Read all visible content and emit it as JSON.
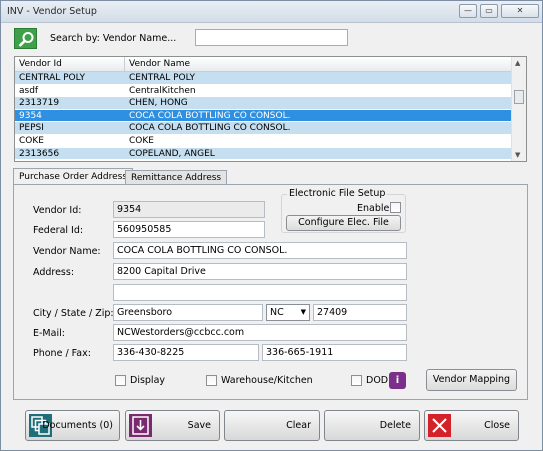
{
  "window": {
    "title": "INV - Vendor Setup",
    "minimize": "—",
    "maximize": "▭",
    "close": "✕"
  },
  "search": {
    "label": "Search by: Vendor Name...",
    "value": ""
  },
  "grid": {
    "columns": [
      "Vendor Id",
      "Vendor Name"
    ],
    "rows": [
      {
        "id": "CENTRAL POLY",
        "name": "CENTRAL POLY",
        "state": "alt"
      },
      {
        "id": "asdf",
        "name": "CentralKitchen",
        "state": ""
      },
      {
        "id": "2313719",
        "name": "CHEN, HONG",
        "state": "alt"
      },
      {
        "id": "9354",
        "name": "COCA COLA BOTTLING CO CONSOL.",
        "state": "sel"
      },
      {
        "id": "PEPSI",
        "name": "COCA COLA BOTTLING CO CONSOL.",
        "state": "alt"
      },
      {
        "id": "COKE",
        "name": "COKE",
        "state": ""
      },
      {
        "id": "2313656",
        "name": "COPELAND, ANGEL",
        "state": "alt"
      }
    ]
  },
  "tabs": {
    "active": "Purchase Order Address",
    "inactive": "Remittance Address"
  },
  "form": {
    "vendor_id_label": "Vendor Id:",
    "vendor_id": "9354",
    "federal_id_label": "Federal Id:",
    "federal_id": "560950585",
    "vendor_name_label": "Vendor Name:",
    "vendor_name": "COCA COLA BOTTLING CO CONSOL.",
    "address_label": "Address:",
    "address1": "8200 Capital Drive",
    "address2": "",
    "csz_label": "City / State / Zip:",
    "city": "Greensboro",
    "state": "NC",
    "zip": "27409",
    "email_label": "E-Mail:",
    "email": "NCWestorders@ccbcc.com",
    "phone_label": "Phone / Fax:",
    "phone": "336-430-8225",
    "fax": "336-665-1911",
    "display_label": "Display",
    "warehouse_label": "Warehouse/Kitchen",
    "dod_label": "DOD",
    "info_glyph": "i",
    "vendor_mapping": "Vendor Mapping"
  },
  "efile": {
    "title": "Electronic File Setup",
    "enable_label": "Enable",
    "configure": "Configure Elec. File"
  },
  "buttons": {
    "documents": "Documents (0)",
    "save": "Save",
    "clear": "Clear",
    "delete": "Delete",
    "close": "Close"
  },
  "colors": {
    "selection": "#2f8fe0",
    "alt_row": "#c6dff0",
    "search_green": "#3fa04a",
    "accent_purple": "#7c2f8a",
    "close_red": "#d2232a"
  }
}
